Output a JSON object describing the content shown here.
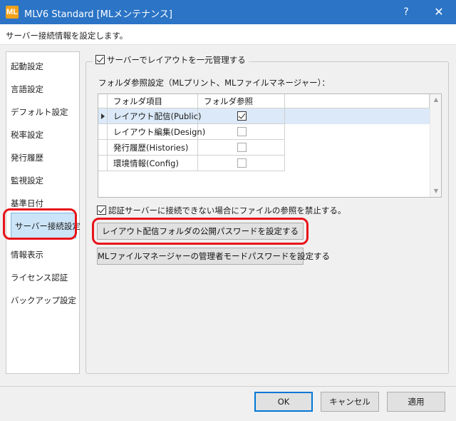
{
  "window": {
    "title": "MLV6 Standard [MLメンテナンス]",
    "icon_text": "ML",
    "help_label": "?",
    "close_label": "✕"
  },
  "description": "サーバー接続情報を設定します。",
  "sidebar": {
    "items": [
      {
        "label": "起動設定"
      },
      {
        "label": "言語設定"
      },
      {
        "label": "デフォルト設定"
      },
      {
        "label": "税率設定"
      },
      {
        "label": "発行履歴"
      },
      {
        "label": "監視設定"
      },
      {
        "label": "基準日付"
      },
      {
        "label": "サーバー接続設定",
        "selected": true
      },
      {
        "label": "情報表示"
      },
      {
        "label": "ライセンス認証"
      },
      {
        "label": "バックアップ設定"
      }
    ]
  },
  "server_manage": {
    "label": "サーバーでレイアウトを一元管理する",
    "checked": true
  },
  "folder_ref": {
    "label": "フォルダ参照設定（MLプリント、MLファイルマネージャー）：",
    "columns": [
      "フォルダ項目",
      "フォルダ参照"
    ],
    "rows": [
      {
        "name": "レイアウト配信(Public)",
        "checked": true,
        "selected": true
      },
      {
        "name": "レイアウト編集(Design)",
        "checked": false,
        "selected": false
      },
      {
        "name": "発行履歴(Histories)",
        "checked": false,
        "selected": false
      },
      {
        "name": "環境情報(Config)",
        "checked": false,
        "selected": false
      }
    ]
  },
  "auth_block": {
    "label": "認証サーバーに接続できない場合にファイルの参照を禁止する。",
    "checked": true
  },
  "buttons": {
    "publish_password": "レイアウト配信フォルダの公開パスワードを設定する",
    "admin_password": "MLファイルマネージャーの管理者モードパスワードを設定する"
  },
  "footer": {
    "ok": "OK",
    "cancel": "キャンセル",
    "apply": "適用"
  },
  "colors": {
    "titlebar": "#2b74c6",
    "highlight": "#e8131a",
    "selection": "#cce4f7"
  }
}
